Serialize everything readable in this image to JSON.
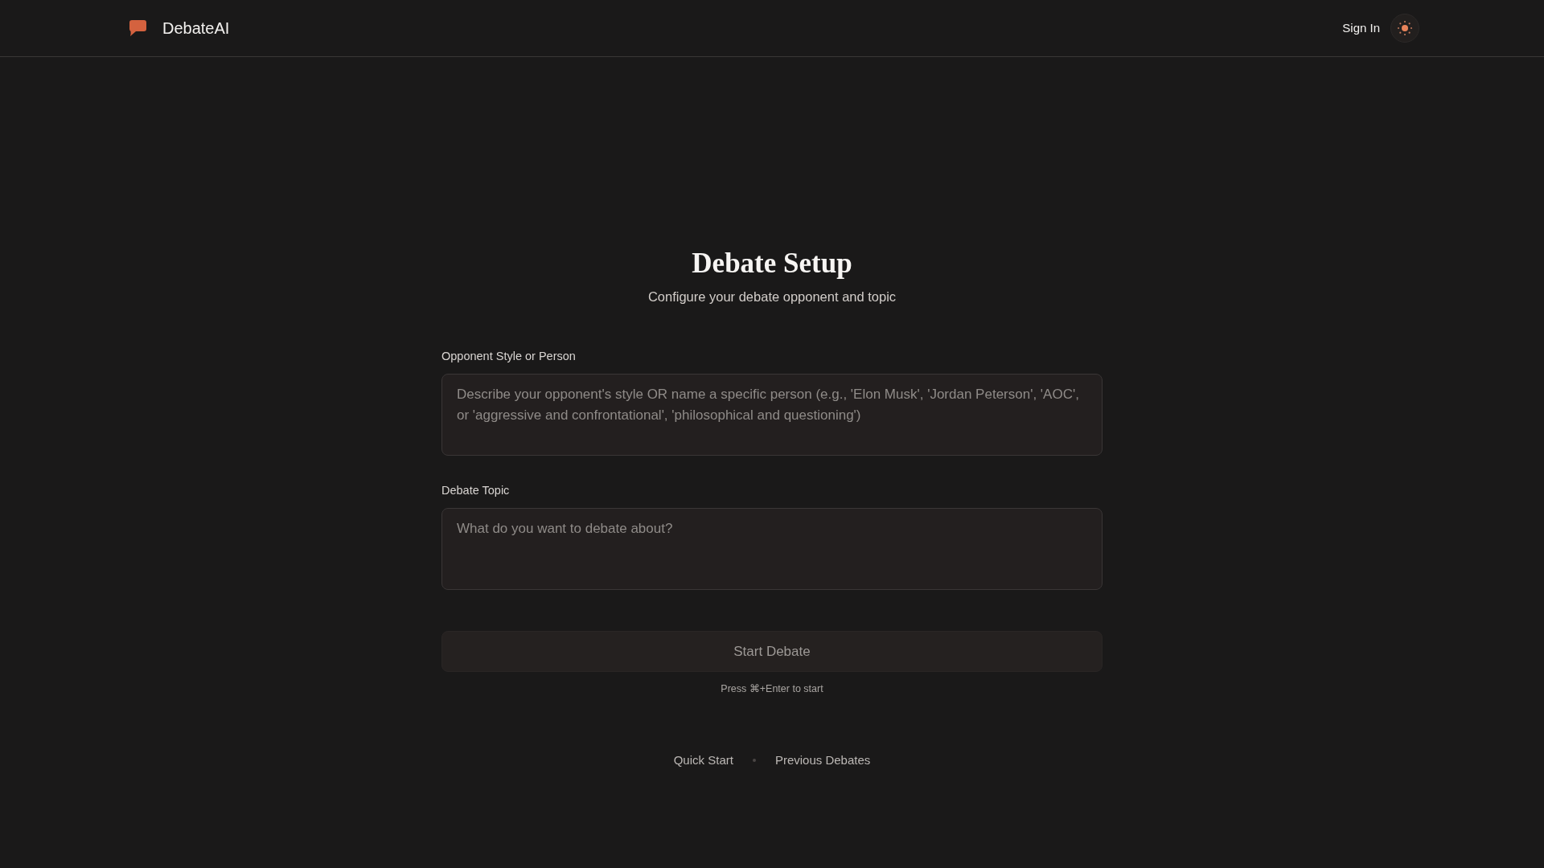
{
  "header": {
    "brand": "DebateAI",
    "sign_in": "Sign In"
  },
  "setup": {
    "title": "Debate Setup",
    "subtitle": "Configure your debate opponent and topic"
  },
  "fields": [
    {
      "label": "Opponent Style or Person",
      "placeholder": "Describe your opponent's style OR name a specific person (e.g., 'Elon Musk', 'Jordan Peterson', 'AOC', or 'aggressive and confrontational', 'philosophical and questioning')"
    },
    {
      "label": "Debate Topic",
      "placeholder": "What do you want to debate about?"
    }
  ],
  "start_button": {
    "label": "Start Debate",
    "disabled": true
  },
  "hint": "Press ⌘+Enter to start",
  "footer_links": [
    "Quick Start",
    "Previous Debates"
  ]
}
